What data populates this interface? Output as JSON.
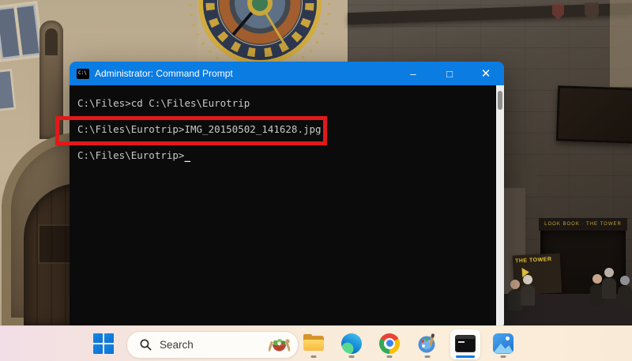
{
  "wallpaper": {
    "description": "Photo of Prague Old Town Hall with astronomical clock, gothic portal and tourists",
    "door_sign_text": "LOOK BOOK · THE TOWER",
    "tower_sign_text": "THE TOWER"
  },
  "window": {
    "title": "Administrator: Command Prompt",
    "titlebar_color": "#0a7ce2",
    "icon_label": "C:\\",
    "controls": {
      "minimize_glyph": "–",
      "maximize_glyph": "□",
      "close_glyph": "✕"
    },
    "terminal": {
      "background_color": "#0b0b0b",
      "text_color": "#c9c9c9",
      "lines": [
        "C:\\Files>cd C:\\Files\\Eurotrip",
        "C:\\Files\\Eurotrip>IMG_20150502_141628.jpg",
        "C:\\Files\\Eurotrip>"
      ],
      "cursor_glyph": "_"
    }
  },
  "annotation": {
    "shape": "rectangle",
    "color": "#e01a1a",
    "highlighted_text": "C:\\Files\\Eurotrip>IMG_20150502_141628.jpg"
  },
  "taskbar": {
    "accent_color": "#0a7ce2",
    "search_placeholder": "Search",
    "search_widget_icon": "salad-bowl-icon",
    "apps": [
      {
        "name": "file-explorer",
        "active": false
      },
      {
        "name": "microsoft-edge",
        "active": false
      },
      {
        "name": "google-chrome",
        "active": false
      },
      {
        "name": "paint",
        "active": false
      },
      {
        "name": "command-prompt",
        "active": true
      },
      {
        "name": "photos",
        "active": false
      }
    ]
  }
}
